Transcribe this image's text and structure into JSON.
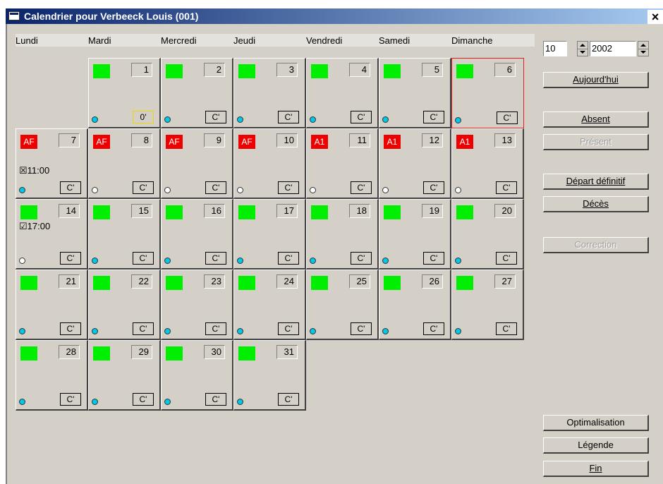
{
  "window": {
    "title": "Calendrier pour Verbeeck Louis (001)",
    "close_label": "×"
  },
  "days": [
    "Lundi",
    "Mardi",
    "Mercredi",
    "Jeudi",
    "Vendredi",
    "Samedi",
    "Dimanche"
  ],
  "month": "10",
  "year": "2002",
  "buttons": {
    "today": "Aujourd'hui",
    "absent": "Absent",
    "present": "Présent",
    "departure": "Départ définitif",
    "death": "Décès",
    "correction": "Correction",
    "optimisation": "Optimalisation",
    "legend": "Légende",
    "end": "Fin"
  },
  "colors": {
    "green_status": "#00ee00",
    "red_status": "#ee0000",
    "cyan_circle": "#00c8e8",
    "selected_border": "#e02020"
  },
  "calendar": [
    {
      "day": "1",
      "status": "green",
      "code": "",
      "circle": "cyan",
      "box": "0'",
      "box_style": "yellow",
      "time": ""
    },
    {
      "day": "2",
      "status": "green",
      "code": "",
      "circle": "cyan",
      "box": "C'",
      "box_style": "",
      "time": ""
    },
    {
      "day": "3",
      "status": "green",
      "code": "",
      "circle": "cyan",
      "box": "C'",
      "box_style": "",
      "time": ""
    },
    {
      "day": "4",
      "status": "green",
      "code": "",
      "circle": "cyan",
      "box": "C'",
      "box_style": "",
      "time": ""
    },
    {
      "day": "5",
      "status": "green",
      "code": "",
      "circle": "cyan",
      "box": "C'",
      "box_style": "",
      "time": ""
    },
    {
      "day": "6",
      "status": "green",
      "code": "",
      "circle": "cyan",
      "box": "C'",
      "box_style": "",
      "time": "",
      "selected": true
    },
    {
      "day": "7",
      "status": "red",
      "code": "AF",
      "circle": "cyan",
      "box": "C'",
      "box_style": "",
      "time": "☒11:00"
    },
    {
      "day": "8",
      "status": "red",
      "code": "AF",
      "circle": "white",
      "box": "C'",
      "box_style": "",
      "time": ""
    },
    {
      "day": "9",
      "status": "red",
      "code": "AF",
      "circle": "white",
      "box": "C'",
      "box_style": "",
      "time": ""
    },
    {
      "day": "10",
      "status": "red",
      "code": "AF",
      "circle": "white",
      "box": "C'",
      "box_style": "",
      "time": ""
    },
    {
      "day": "11",
      "status": "red",
      "code": "A1",
      "circle": "white",
      "box": "C'",
      "box_style": "",
      "time": ""
    },
    {
      "day": "12",
      "status": "red",
      "code": "A1",
      "circle": "white",
      "box": "C'",
      "box_style": "",
      "time": ""
    },
    {
      "day": "13",
      "status": "red",
      "code": "A1",
      "circle": "white",
      "box": "C'",
      "box_style": "",
      "time": ""
    },
    {
      "day": "14",
      "status": "green",
      "code": "",
      "circle": "white",
      "box": "C'",
      "box_style": "",
      "time": "☑17:00"
    },
    {
      "day": "15",
      "status": "green",
      "code": "",
      "circle": "cyan",
      "box": "C'",
      "box_style": "",
      "time": ""
    },
    {
      "day": "16",
      "status": "green",
      "code": "",
      "circle": "cyan",
      "box": "C'",
      "box_style": "",
      "time": ""
    },
    {
      "day": "17",
      "status": "green",
      "code": "",
      "circle": "cyan",
      "box": "C'",
      "box_style": "",
      "time": ""
    },
    {
      "day": "18",
      "status": "green",
      "code": "",
      "circle": "cyan",
      "box": "C'",
      "box_style": "",
      "time": ""
    },
    {
      "day": "19",
      "status": "green",
      "code": "",
      "circle": "cyan",
      "box": "C'",
      "box_style": "",
      "time": ""
    },
    {
      "day": "20",
      "status": "green",
      "code": "",
      "circle": "cyan",
      "box": "C'",
      "box_style": "",
      "time": ""
    },
    {
      "day": "21",
      "status": "green",
      "code": "",
      "circle": "cyan",
      "box": "C'",
      "box_style": "",
      "time": ""
    },
    {
      "day": "22",
      "status": "green",
      "code": "",
      "circle": "cyan",
      "box": "C'",
      "box_style": "",
      "time": ""
    },
    {
      "day": "23",
      "status": "green",
      "code": "",
      "circle": "cyan",
      "box": "C'",
      "box_style": "",
      "time": ""
    },
    {
      "day": "24",
      "status": "green",
      "code": "",
      "circle": "cyan",
      "box": "C'",
      "box_style": "",
      "time": ""
    },
    {
      "day": "25",
      "status": "green",
      "code": "",
      "circle": "cyan",
      "box": "C'",
      "box_style": "",
      "time": ""
    },
    {
      "day": "26",
      "status": "green",
      "code": "",
      "circle": "cyan",
      "box": "C'",
      "box_style": "",
      "time": ""
    },
    {
      "day": "27",
      "status": "green",
      "code": "",
      "circle": "cyan",
      "box": "C'",
      "box_style": "",
      "time": ""
    },
    {
      "day": "28",
      "status": "green",
      "code": "",
      "circle": "cyan",
      "box": "C'",
      "box_style": "",
      "time": ""
    },
    {
      "day": "29",
      "status": "green",
      "code": "",
      "circle": "cyan",
      "box": "C'",
      "box_style": "",
      "time": ""
    },
    {
      "day": "30",
      "status": "green",
      "code": "",
      "circle": "cyan",
      "box": "C'",
      "box_style": "",
      "time": ""
    },
    {
      "day": "31",
      "status": "green",
      "code": "",
      "circle": "cyan",
      "box": "C'",
      "box_style": "",
      "time": ""
    }
  ]
}
